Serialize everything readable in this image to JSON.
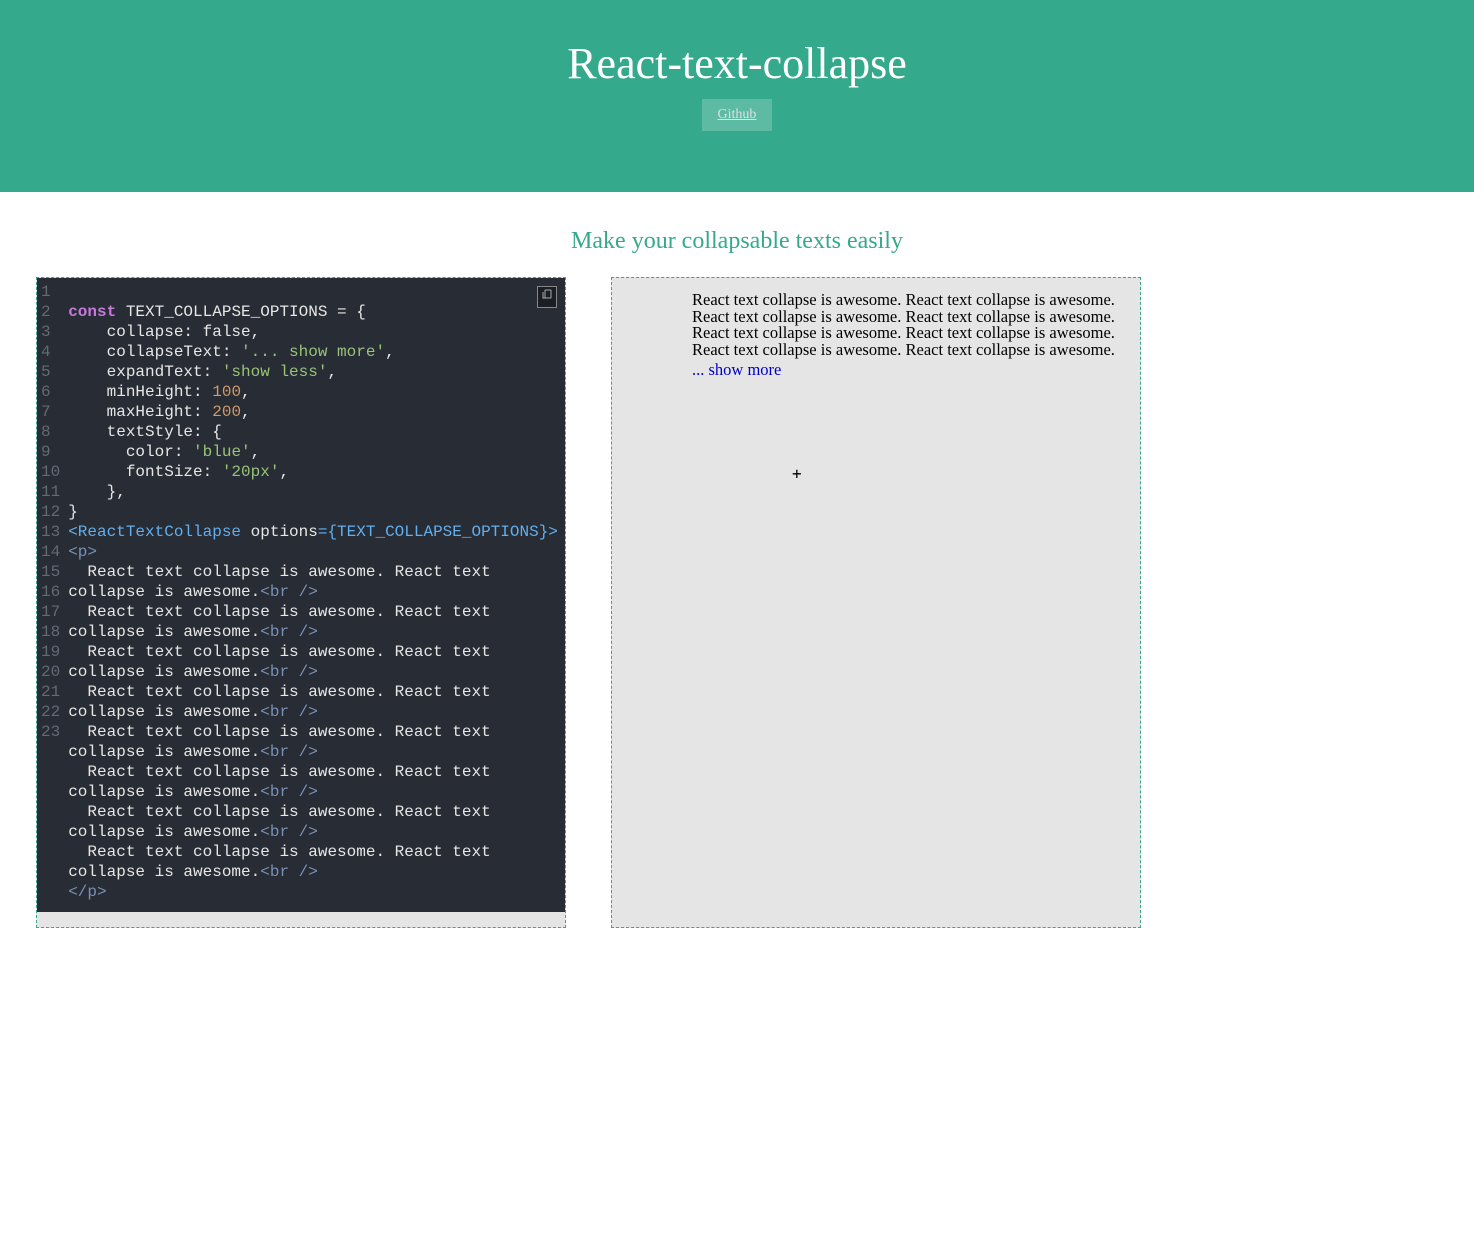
{
  "header": {
    "title": "React-text-collapse",
    "github_label": "Github"
  },
  "tagline": "Make your collapsable texts easily",
  "code": {
    "line_numbers": "1\n2\n3\n4\n5\n6\n7\n8\n9\n10\n11\n12\n13\n14\n15\n16\n17\n18\n19\n20\n21\n22\n23",
    "const_kw": "const",
    "var_name": " TEXT_COLLAPSE_OPTIONS = {",
    "collapse_line": "    collapse: false,",
    "collapseText_key": "    collapseText: ",
    "collapseText_val": "'... show more'",
    "comma1": ",",
    "expandText_key": "    expandText: ",
    "expandText_val": "'show less'",
    "comma2": ",",
    "minHeight_key": "    minHeight: ",
    "minHeight_val": "100",
    "comma3": ",",
    "maxHeight_key": "    maxHeight: ",
    "maxHeight_val": "200",
    "comma4": ",",
    "textStyle_line": "    textStyle: {",
    "color_key": "      color: ",
    "color_val": "'blue'",
    "comma5": ",",
    "fontSize_key": "      fontSize: ",
    "fontSize_val": "'20px'",
    "comma6": ",",
    "close_inner": "    },",
    "close_outer": "}",
    "jsx_open1": "<ReactTextCollapse",
    "jsx_attr": " options",
    "jsx_eq": "=",
    "jsx_val": "{TEXT_COLLAPSE_OPTIONS}",
    "jsx_close": ">",
    "p_open": "<p>",
    "text_line": "  React text collapse is awesome. React text collapse is awesome.",
    "br_tag": "<br />",
    "p_close": "</p>"
  },
  "preview": {
    "line": "React text collapse is awesome. React text collapse is awesome.",
    "show_more": "... show more",
    "plus": "+"
  }
}
